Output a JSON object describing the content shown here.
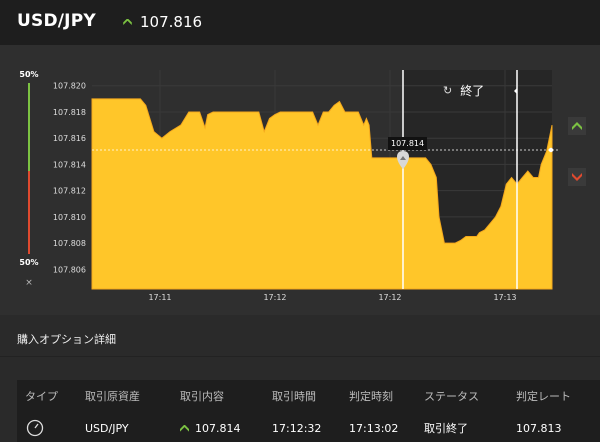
{
  "header": {
    "pair": "USD/JPY",
    "rate": "107.816"
  },
  "sentiment": {
    "top": "50%",
    "bottom": "50%",
    "close": "×"
  },
  "expiry": {
    "label": "終了"
  },
  "flag": {
    "value": "107.814"
  },
  "y_ticks": [
    "107.820",
    "107.818",
    "107.816",
    "107.814",
    "107.812",
    "107.810",
    "107.808",
    "107.806"
  ],
  "x_ticks": [
    "17:11",
    "17:12",
    "17:12",
    "17:13"
  ],
  "details": {
    "title": "購入オプション詳細",
    "columns": [
      "タイプ",
      "取引原資産",
      "取引内容",
      "取引時間",
      "判定時刻",
      "ステータス",
      "判定レート"
    ],
    "row": {
      "asset": "USD/JPY",
      "content": "107.814",
      "time": "17:12:32",
      "judge_time": "17:13:02",
      "status": "取引終了",
      "rate": "107.813"
    }
  },
  "colors": {
    "area": "#ffc629",
    "up": "#7cc242",
    "down": "#e04a2f"
  },
  "chart_data": {
    "type": "area",
    "y_ticks": [
      107.82,
      107.818,
      107.816,
      107.814,
      107.812,
      107.81,
      107.808,
      107.806
    ],
    "ylim": [
      107.8045,
      107.8212
    ],
    "x": [
      0,
      4,
      8,
      13,
      16,
      18,
      20,
      23,
      26,
      29,
      33,
      36,
      40,
      42,
      43,
      45,
      47,
      50,
      53,
      56,
      58,
      60,
      62,
      64,
      66,
      68,
      70,
      73,
      76,
      79,
      82,
      84,
      86,
      88,
      90,
      92,
      94,
      95,
      97,
      99,
      101,
      102,
      103,
      104,
      106,
      108,
      110,
      112,
      114,
      116,
      118,
      120,
      122,
      124,
      126,
      128,
      129,
      131,
      133,
      135,
      137,
      139,
      141,
      143,
      144,
      146,
      148,
      150,
      152,
      154,
      156,
      158,
      160,
      162,
      164,
      166,
      167,
      169,
      171
    ],
    "y": [
      107.819,
      107.819,
      107.819,
      107.819,
      107.819,
      107.819,
      107.8185,
      107.8165,
      107.816,
      107.8165,
      107.817,
      107.818,
      107.818,
      107.8168,
      107.8178,
      107.818,
      107.818,
      107.818,
      107.818,
      107.818,
      107.818,
      107.818,
      107.818,
      107.8165,
      107.8175,
      107.8178,
      107.818,
      107.818,
      107.818,
      107.818,
      107.818,
      107.817,
      107.818,
      107.818,
      107.8185,
      107.8188,
      107.818,
      107.818,
      107.818,
      107.818,
      107.817,
      107.8175,
      107.817,
      107.8145,
      107.8145,
      107.8145,
      107.8145,
      107.8145,
      107.8145,
      107.8145,
      107.8145,
      107.8145,
      107.8145,
      107.8145,
      107.814,
      107.813,
      107.81,
      107.808,
      107.808,
      107.808,
      107.8082,
      107.8085,
      107.8085,
      107.8085,
      107.8088,
      107.809,
      107.8095,
      107.81,
      107.8108,
      107.8125,
      107.813,
      107.8125,
      107.813,
      107.8135,
      107.813,
      107.813,
      107.814,
      107.815,
      107.817
    ],
    "x_ticks": [
      "17:11",
      "17:12",
      "17:12",
      "17:13"
    ],
    "current": 107.816
  }
}
